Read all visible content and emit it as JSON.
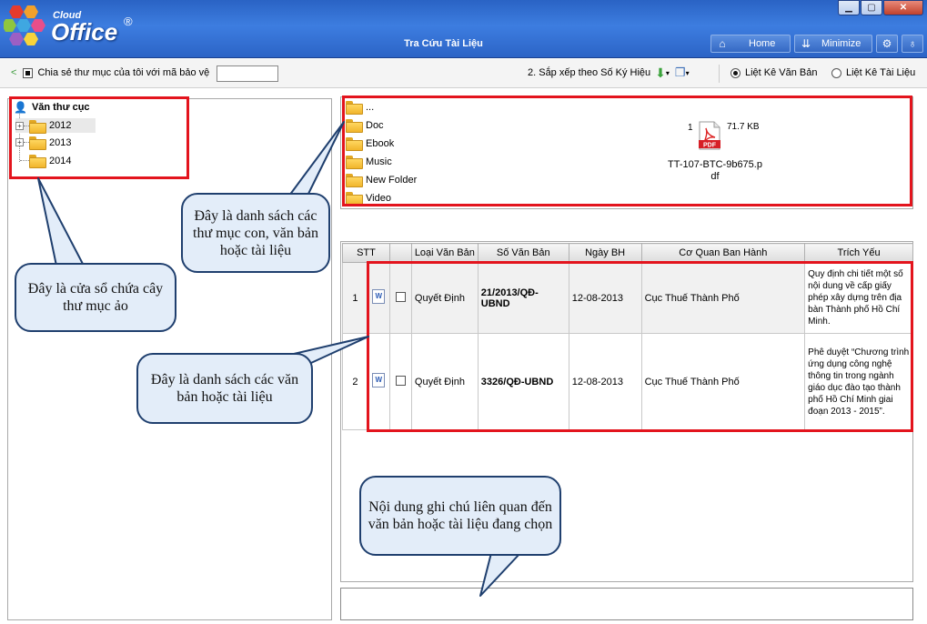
{
  "app": {
    "logo_small": "Cloud",
    "logo_big": "Office",
    "logo_reg": "®",
    "title": "Tra Cứu Tài Liệu",
    "home_label": "Home",
    "minimize_label": "Minimize"
  },
  "toolbar": {
    "share_label": "Chia sẻ thư mục của tôi với mã bảo vệ",
    "share_code": "",
    "sort_label": "2. Sắp xếp theo Số Ký Hiệu",
    "radio_docs": "Liệt Kê Văn Bản",
    "radio_files": "Liệt Kê Tài Liệu"
  },
  "tree": {
    "root": "Văn thư cục",
    "items": [
      "2012",
      "2013",
      "2014"
    ]
  },
  "folders": [
    "...",
    "Doc",
    "Ebook",
    "Music",
    "New Folder",
    "Video"
  ],
  "file": {
    "index": "1",
    "size": "71.7 KB",
    "name_line1": "TT-107-BTC-9b675.p",
    "name_line2": "df"
  },
  "table": {
    "headers": [
      "STT",
      "Loại Văn Bản",
      "Số Văn Bản",
      "Ngày BH",
      "Cơ Quan Ban Hành",
      "Trích Yếu"
    ],
    "rows": [
      {
        "stt": "1",
        "type": "Quyết Định",
        "number": "21/2013/QĐ-UBND",
        "date": "12-08-2013",
        "agency": "Cục Thuế Thành Phố",
        "summary": "Quy định chi tiết một số nội dung về cấp giấy phép xây dựng trên địa bàn Thành phố Hồ Chí Minh."
      },
      {
        "stt": "2",
        "type": "Quyết Định",
        "number": "3326/QĐ-UBND",
        "date": "12-08-2013",
        "agency": "Cục Thuế Thành Phố",
        "summary": "Phê duyệt “Chương trình ứng dụng công nghệ thông tin trong ngành giáo dục đào tạo thành phố Hồ Chí Minh giai đoạn 2013 - 2015”."
      }
    ]
  },
  "callouts": {
    "tree": "Đây là cửa sổ chứa cây thư mục ảo",
    "folders": "Đây là danh sách các thư mục con, văn bản hoặc tài liệu",
    "docs": "Đây là danh sách các văn bản hoặc tài liệu",
    "note": "Nội dung ghi chú liên quan đến văn bản hoặc tài liệu đang chọn"
  },
  "colors": {
    "title_bar": "#2a63c4",
    "highlight_box": "#e3141d",
    "callout_fill": "#e3edf9"
  }
}
